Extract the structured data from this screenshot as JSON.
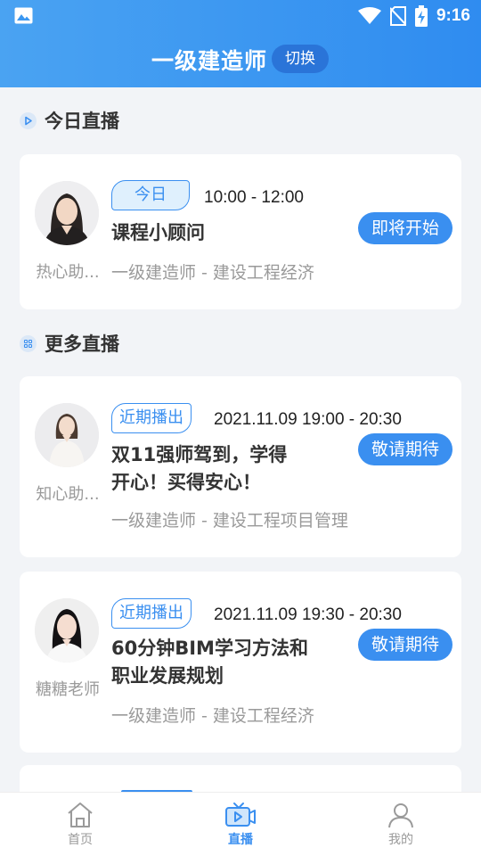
{
  "status_bar": {
    "time": "9:16"
  },
  "header": {
    "title": "一级建造师",
    "switch_label": "切换"
  },
  "today_section": {
    "title": "今日直播"
  },
  "more_section": {
    "title": "更多直播"
  },
  "today_card": {
    "teacher": "热心助...",
    "badge": "今日",
    "time": "10:00 - 12:00",
    "title": "课程小顾问",
    "subtitle": "一级建造师 - 建设工程经济",
    "action": "即将开始"
  },
  "more_cards": [
    {
      "teacher": "知心助...",
      "badge": "近期播出",
      "time": "2021.11.09 19:00 - 20:30",
      "title_line1": "双11强师驾到，学得",
      "title_line2": "开心！买得安心！",
      "subtitle": "一级建造师 - 建设工程项目管理",
      "action": "敬请期待"
    },
    {
      "teacher": "糖糖老师",
      "badge": "近期播出",
      "time": "2021.11.09 19:30 - 20:30",
      "title_line1": "60分钟BIM学习方法和",
      "title_line2": "职业发展规划",
      "subtitle": "一级建造师 - 建设工程经济",
      "action": "敬请期待"
    }
  ],
  "tabs": [
    {
      "label": "首页",
      "icon": "home-icon",
      "active": false
    },
    {
      "label": "直播",
      "icon": "live-tv-icon",
      "active": true
    },
    {
      "label": "我的",
      "icon": "profile-icon",
      "active": false
    }
  ],
  "colors": {
    "accent": "#3a8ff0",
    "header_start": "#4aa3f2",
    "header_end": "#2f8cf0",
    "inactive": "#999999"
  }
}
